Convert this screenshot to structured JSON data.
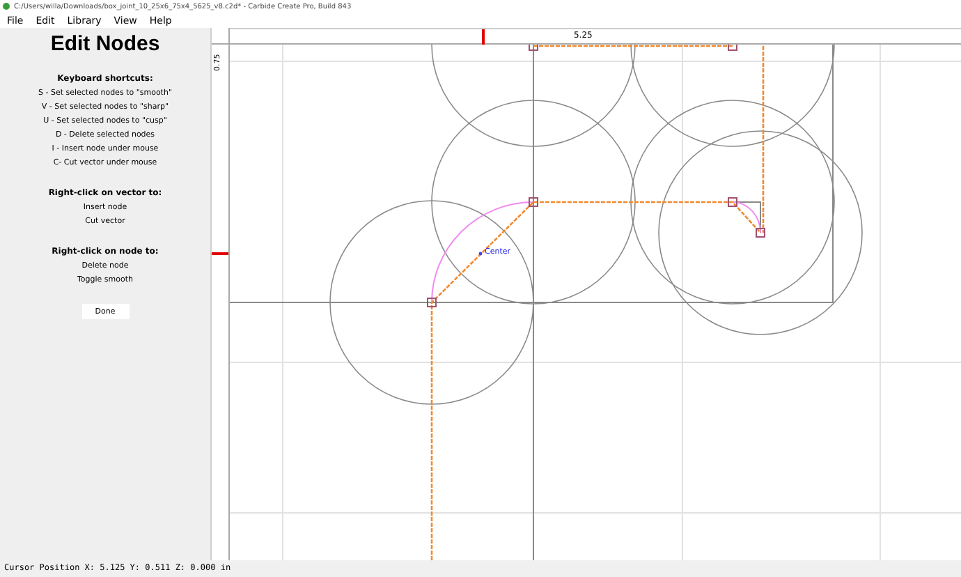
{
  "window": {
    "title": "C:/Users/willa/Downloads/box_joint_10_25x6_75x4_5625_v8.c2d* - Carbide Create Pro, Build 843"
  },
  "menu": [
    {
      "label": "File"
    },
    {
      "label": "Edit"
    },
    {
      "label": "Library"
    },
    {
      "label": "View"
    },
    {
      "label": "Help"
    }
  ],
  "panel": {
    "title": "Edit Nodes",
    "sections": [
      {
        "heading": "Keyboard shortcuts:",
        "lines": [
          "S - Set selected nodes to \"smooth\"",
          "V - Set selected nodes to \"sharp\"",
          "U - Set selected nodes to \"cusp\"",
          "D - Delete selected nodes",
          "I - Insert node under mouse",
          "C- Cut vector under mouse"
        ]
      },
      {
        "heading": "Right-click on vector to:",
        "lines": [
          "Insert node",
          "Cut vector"
        ]
      },
      {
        "heading": "Right-click on node to:",
        "lines": [
          "Delete node",
          "Toggle smooth"
        ]
      }
    ],
    "button": "Done"
  },
  "rulers": {
    "top_label": "5.25",
    "left_label": "0.75"
  },
  "canvas": {
    "marker_label": "Center"
  },
  "status_bar": "Cursor Position X: 5.125 Y: 0.511 Z: 0.000 in"
}
